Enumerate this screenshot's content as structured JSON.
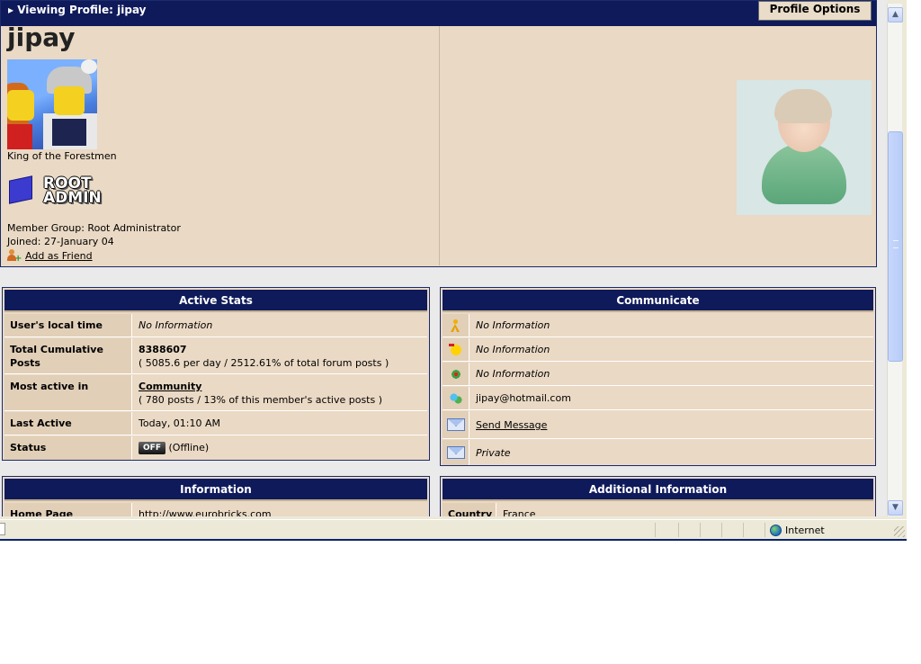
{
  "profile": {
    "header_title": "Viewing Profile: jipay",
    "options_button": "Profile Options",
    "username": "jipay",
    "user_title": "King of the Forestmen",
    "rank_line1": "ROOT",
    "rank_line2": "ADMIN",
    "member_group": "Member Group: Root Administrator",
    "joined": "Joined: 27-January 04",
    "add_friend": "Add as Friend"
  },
  "active_stats": {
    "title": "Active Stats",
    "local_time_label": "User's local time",
    "local_time_value": "No Information",
    "posts_label": "Total Cumulative Posts",
    "posts_value": "8388607",
    "posts_detail": "( 5085.6 per day / 2512.61% of total forum posts )",
    "most_active_label": "Most active in",
    "most_active_value": "Community",
    "most_active_detail": "( 780 posts / 13% of this member's active posts )",
    "last_active_label": "Last Active",
    "last_active_value": "Today, 01:10 AM",
    "status_label": "Status",
    "status_badge": "OFF",
    "status_value": "(Offline)"
  },
  "communicate": {
    "title": "Communicate",
    "aim": "No Information",
    "yahoo": "No Information",
    "icq": "No Information",
    "msn": "jipay@hotmail.com",
    "send_message": "Send Message",
    "email": "Private"
  },
  "information": {
    "title": "Information",
    "home_page_label": "Home Page",
    "home_page_value": "http://www.eurobricks.com"
  },
  "additional": {
    "title": "Additional Information",
    "country_label": "Country",
    "country_value": "France"
  },
  "statusbar": {
    "zone": "Internet"
  }
}
